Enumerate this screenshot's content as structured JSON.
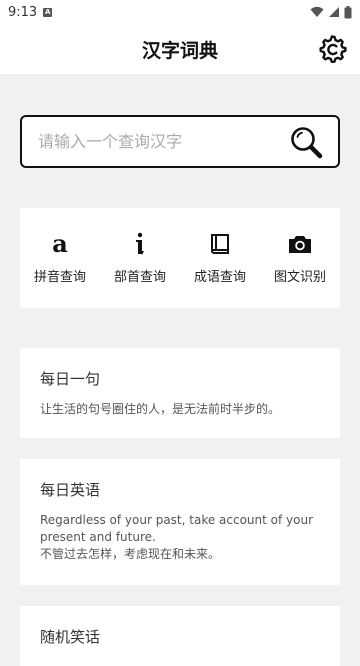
{
  "status_bar": {
    "time": "9:13"
  },
  "app_bar": {
    "title": "汉字词典"
  },
  "search": {
    "placeholder": "请输入一个查询汉字",
    "value": ""
  },
  "features": [
    {
      "icon": "pinyin-a-icon",
      "label": "拼音查询"
    },
    {
      "icon": "radical-i-icon",
      "label": "部首查询"
    },
    {
      "icon": "book-icon",
      "label": "成语查询"
    },
    {
      "icon": "camera-icon",
      "label": "图文识别"
    }
  ],
  "daily_sentence": {
    "title": "每日一句",
    "text": "让生活的句号圈住的人，是无法前时半步的。"
  },
  "daily_english": {
    "title": "每日英语",
    "english": "Regardless of your past, take account of your present and future.",
    "chinese": "不管过去怎样，考虑现在和未来。"
  },
  "random_joke": {
    "title": "随机笑话"
  }
}
